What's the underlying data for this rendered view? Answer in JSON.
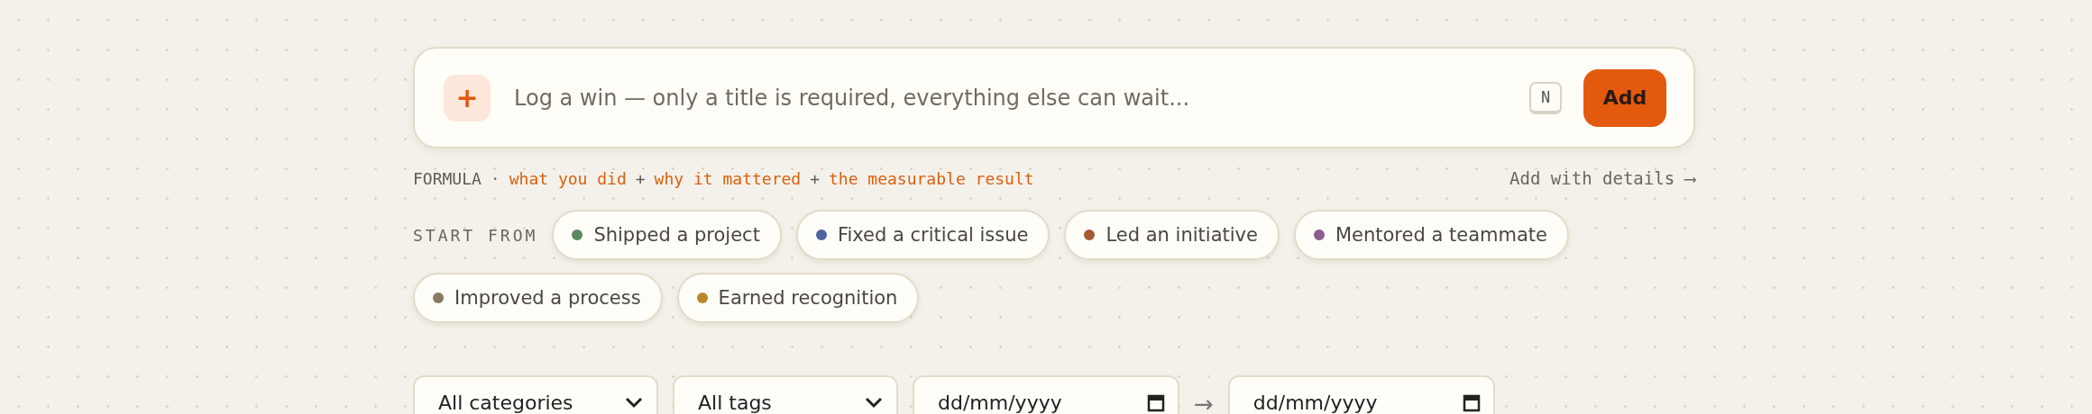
{
  "quick_add": {
    "icon": "+",
    "placeholder": "Log a win — only a title is required, everything else can wait...",
    "shortcut": "N",
    "button": "Add"
  },
  "formula": {
    "label": "FORMULA",
    "separator": "·",
    "parts": [
      {
        "kind": "term",
        "text": "what you did"
      },
      {
        "kind": "op",
        "text": "+"
      },
      {
        "kind": "term",
        "text": "why it mattered"
      },
      {
        "kind": "op",
        "text": "+"
      },
      {
        "kind": "term",
        "text": "the measurable result"
      }
    ],
    "link": "Add with details ⟶"
  },
  "templates": {
    "label": "START FROM",
    "items": [
      {
        "label": "Shipped a project",
        "color": "#5a8a5e"
      },
      {
        "label": "Fixed a critical issue",
        "color": "#4e64a0"
      },
      {
        "label": "Led an initiative",
        "color": "#a35a32"
      },
      {
        "label": "Mentored a teammate",
        "color": "#8a5e8e"
      },
      {
        "label": "Improved a process",
        "color": "#8a7a62"
      },
      {
        "label": "Earned recognition",
        "color": "#b8892a"
      }
    ]
  },
  "filters": [
    {
      "kind": "select",
      "value": "All categories"
    },
    {
      "kind": "select",
      "value": "All tags"
    },
    {
      "kind": "date",
      "placeholder": "dd/mm/yyyy"
    },
    {
      "kind": "arrow",
      "text": "→"
    },
    {
      "kind": "date",
      "placeholder": "dd/mm/yyyy"
    }
  ]
}
